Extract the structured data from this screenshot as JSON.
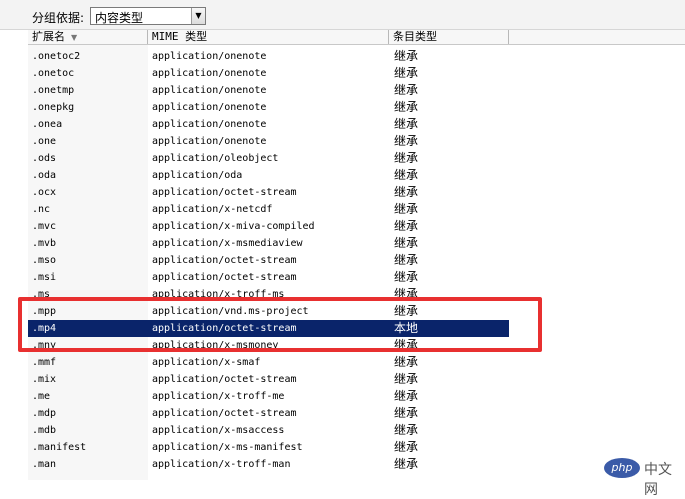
{
  "toolbar": {
    "group_label": "分组依据:",
    "group_value": "内容类型"
  },
  "columns": {
    "extension": "扩展名",
    "mime": "MIME 类型",
    "entry_type": "条目类型"
  },
  "rows": [
    {
      "ext": ".onetoc2",
      "mime": "application/onenote",
      "type": "继承"
    },
    {
      "ext": ".onetoc",
      "mime": "application/onenote",
      "type": "继承"
    },
    {
      "ext": ".onetmp",
      "mime": "application/onenote",
      "type": "继承"
    },
    {
      "ext": ".onepkg",
      "mime": "application/onenote",
      "type": "继承"
    },
    {
      "ext": ".onea",
      "mime": "application/onenote",
      "type": "继承"
    },
    {
      "ext": ".one",
      "mime": "application/onenote",
      "type": "继承"
    },
    {
      "ext": ".ods",
      "mime": "application/oleobject",
      "type": "继承"
    },
    {
      "ext": ".oda",
      "mime": "application/oda",
      "type": "继承"
    },
    {
      "ext": ".ocx",
      "mime": "application/octet-stream",
      "type": "继承"
    },
    {
      "ext": ".nc",
      "mime": "application/x-netcdf",
      "type": "继承"
    },
    {
      "ext": ".mvc",
      "mime": "application/x-miva-compiled",
      "type": "继承"
    },
    {
      "ext": ".mvb",
      "mime": "application/x-msmediaview",
      "type": "继承"
    },
    {
      "ext": ".mso",
      "mime": "application/octet-stream",
      "type": "继承"
    },
    {
      "ext": ".msi",
      "mime": "application/octet-stream",
      "type": "继承"
    },
    {
      "ext": ".ms",
      "mime": "application/x-troff-ms",
      "type": "继承"
    },
    {
      "ext": ".mpp",
      "mime": "application/vnd.ms-project",
      "type": "继承"
    },
    {
      "ext": ".mp4",
      "mime": "application/octet-stream",
      "type": "本地"
    },
    {
      "ext": ".mny",
      "mime": "application/x-msmoney",
      "type": "继承"
    },
    {
      "ext": ".mmf",
      "mime": "application/x-smaf",
      "type": "继承"
    },
    {
      "ext": ".mix",
      "mime": "application/octet-stream",
      "type": "继承"
    },
    {
      "ext": ".me",
      "mime": "application/x-troff-me",
      "type": "继承"
    },
    {
      "ext": ".mdp",
      "mime": "application/octet-stream",
      "type": "继承"
    },
    {
      "ext": ".mdb",
      "mime": "application/x-msaccess",
      "type": "继承"
    },
    {
      "ext": ".manifest",
      "mime": "application/x-ms-manifest",
      "type": "继承"
    },
    {
      "ext": ".man",
      "mime": "application/x-troff-man",
      "type": "继承"
    }
  ],
  "selected_row": 16,
  "watermark": {
    "logo": "php",
    "text": "中文网"
  }
}
